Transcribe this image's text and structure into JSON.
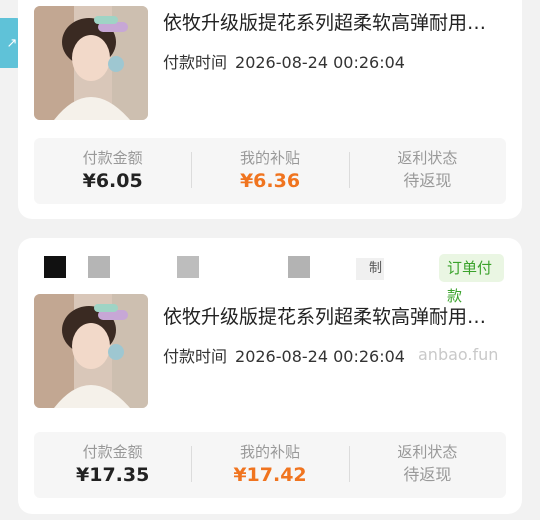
{
  "side_tab": {
    "icon": "arrow-icon",
    "glyph": "↗"
  },
  "cards": [
    {
      "title": "依牧升级版提花系列超柔软高弹耐用…",
      "pay_time_label": "付款时间",
      "pay_time_value": "2026-08-24 00:26:04",
      "stats": {
        "amount_label": "付款金额",
        "amount_value": "¥6.05",
        "subsidy_label": "我的补贴",
        "subsidy_value": "¥6.36",
        "rebate_label": "返利状态",
        "rebate_value": "待返现"
      }
    },
    {
      "header_chip": "制",
      "order_status": "订单付款",
      "title": "依牧升级版提花系列超柔软高弹耐用…",
      "pay_time_label": "付款时间",
      "pay_time_value": "2026-08-24 00:26:04",
      "watermark": "anbao.fun",
      "stats": {
        "amount_label": "付款金额",
        "amount_value": "¥17.35",
        "subsidy_label": "我的补贴",
        "subsidy_value": "¥17.42",
        "rebate_label": "返利状态",
        "rebate_value": "待返现"
      }
    }
  ],
  "colors": {
    "accent_orange": "#f0741f",
    "status_green": "#3aa22b",
    "side_tab": "#5fc2d8"
  }
}
